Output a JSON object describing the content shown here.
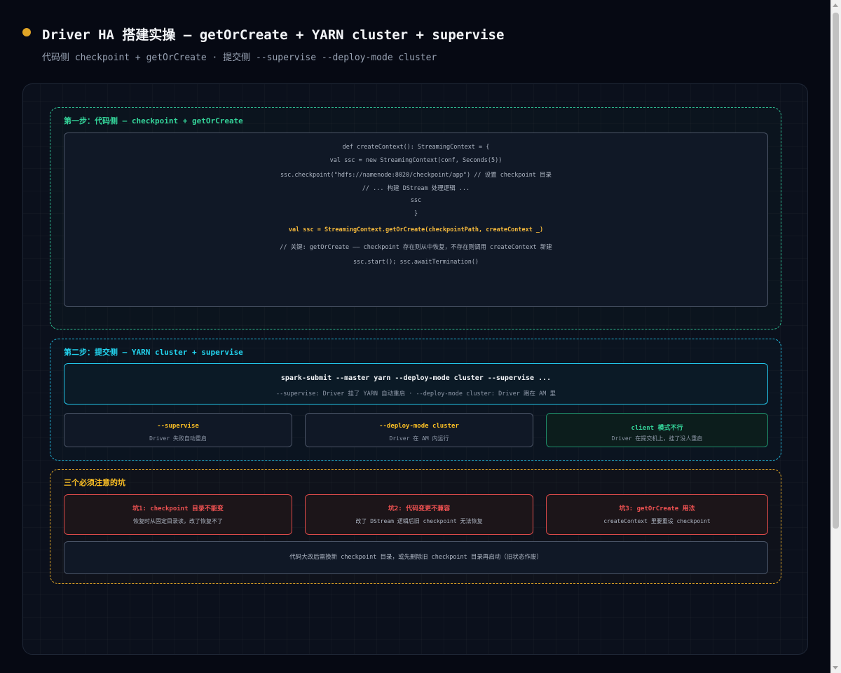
{
  "header": {
    "title": "Driver HA 搭建实操 — getOrCreate + YARN cluster + supervise",
    "subtitle": "代码侧 checkpoint + getOrCreate · 提交侧 --supervise --deploy-mode cluster"
  },
  "step1": {
    "title": "第一步：代码侧 — checkpoint + getOrCreate",
    "code_lines": [
      "def createContext(): StreamingContext = {",
      "val ssc = new StreamingContext(conf, Seconds(5))",
      "ssc.checkpoint(\"hdfs://namenode:8020/checkpoint/app\") // 设置 checkpoint 目录",
      "// ... 构建 DStream 处理逻辑 ...",
      "ssc",
      "}",
      "val ssc = StreamingContext.getOrCreate(checkpointPath, createContext _)",
      "// 关键: getOrCreate —— checkpoint 存在则从中恢复，不存在则调用 createContext 新建",
      "ssc.start(); ssc.awaitTermination()"
    ]
  },
  "step2": {
    "title": "第二步：提交侧 — YARN cluster + supervise",
    "command": "spark-submit --master yarn --deploy-mode cluster --supervise ...",
    "command_note": "--supervise: Driver 挂了 YARN 自动重启 · --deploy-mode cluster: Driver 跑在 AM 里",
    "cards": [
      {
        "title": "--supervise",
        "desc": "Driver 失败自动重启"
      },
      {
        "title": "--deploy-mode cluster",
        "desc": "Driver 在 AM 内运行"
      },
      {
        "title": "client 模式不行",
        "desc": "Driver 在提交机上，挂了没人重启"
      }
    ]
  },
  "pitfalls": {
    "title": "三个必须注意的坑",
    "items": [
      {
        "title": "坑1: checkpoint 目录不能变",
        "desc": "恢复时从固定目录读，改了恢复不了"
      },
      {
        "title": "坑2: 代码变更不兼容",
        "desc": "改了 DStream 逻辑后旧 checkpoint 无法恢复"
      },
      {
        "title": "坑3: getOrCreate 用法",
        "desc": "createContext 里要重设 checkpoint"
      }
    ],
    "tip": "代码大改后需换新 checkpoint 目录，或先删除旧 checkpoint 目录再启动（旧状态作废）"
  },
  "colors": {
    "step1_accent": "#34d399",
    "step2_accent": "#22d3ee",
    "pitfall_accent": "#fbbf24",
    "danger": "#f05252",
    "bullet": "#e0a526"
  }
}
